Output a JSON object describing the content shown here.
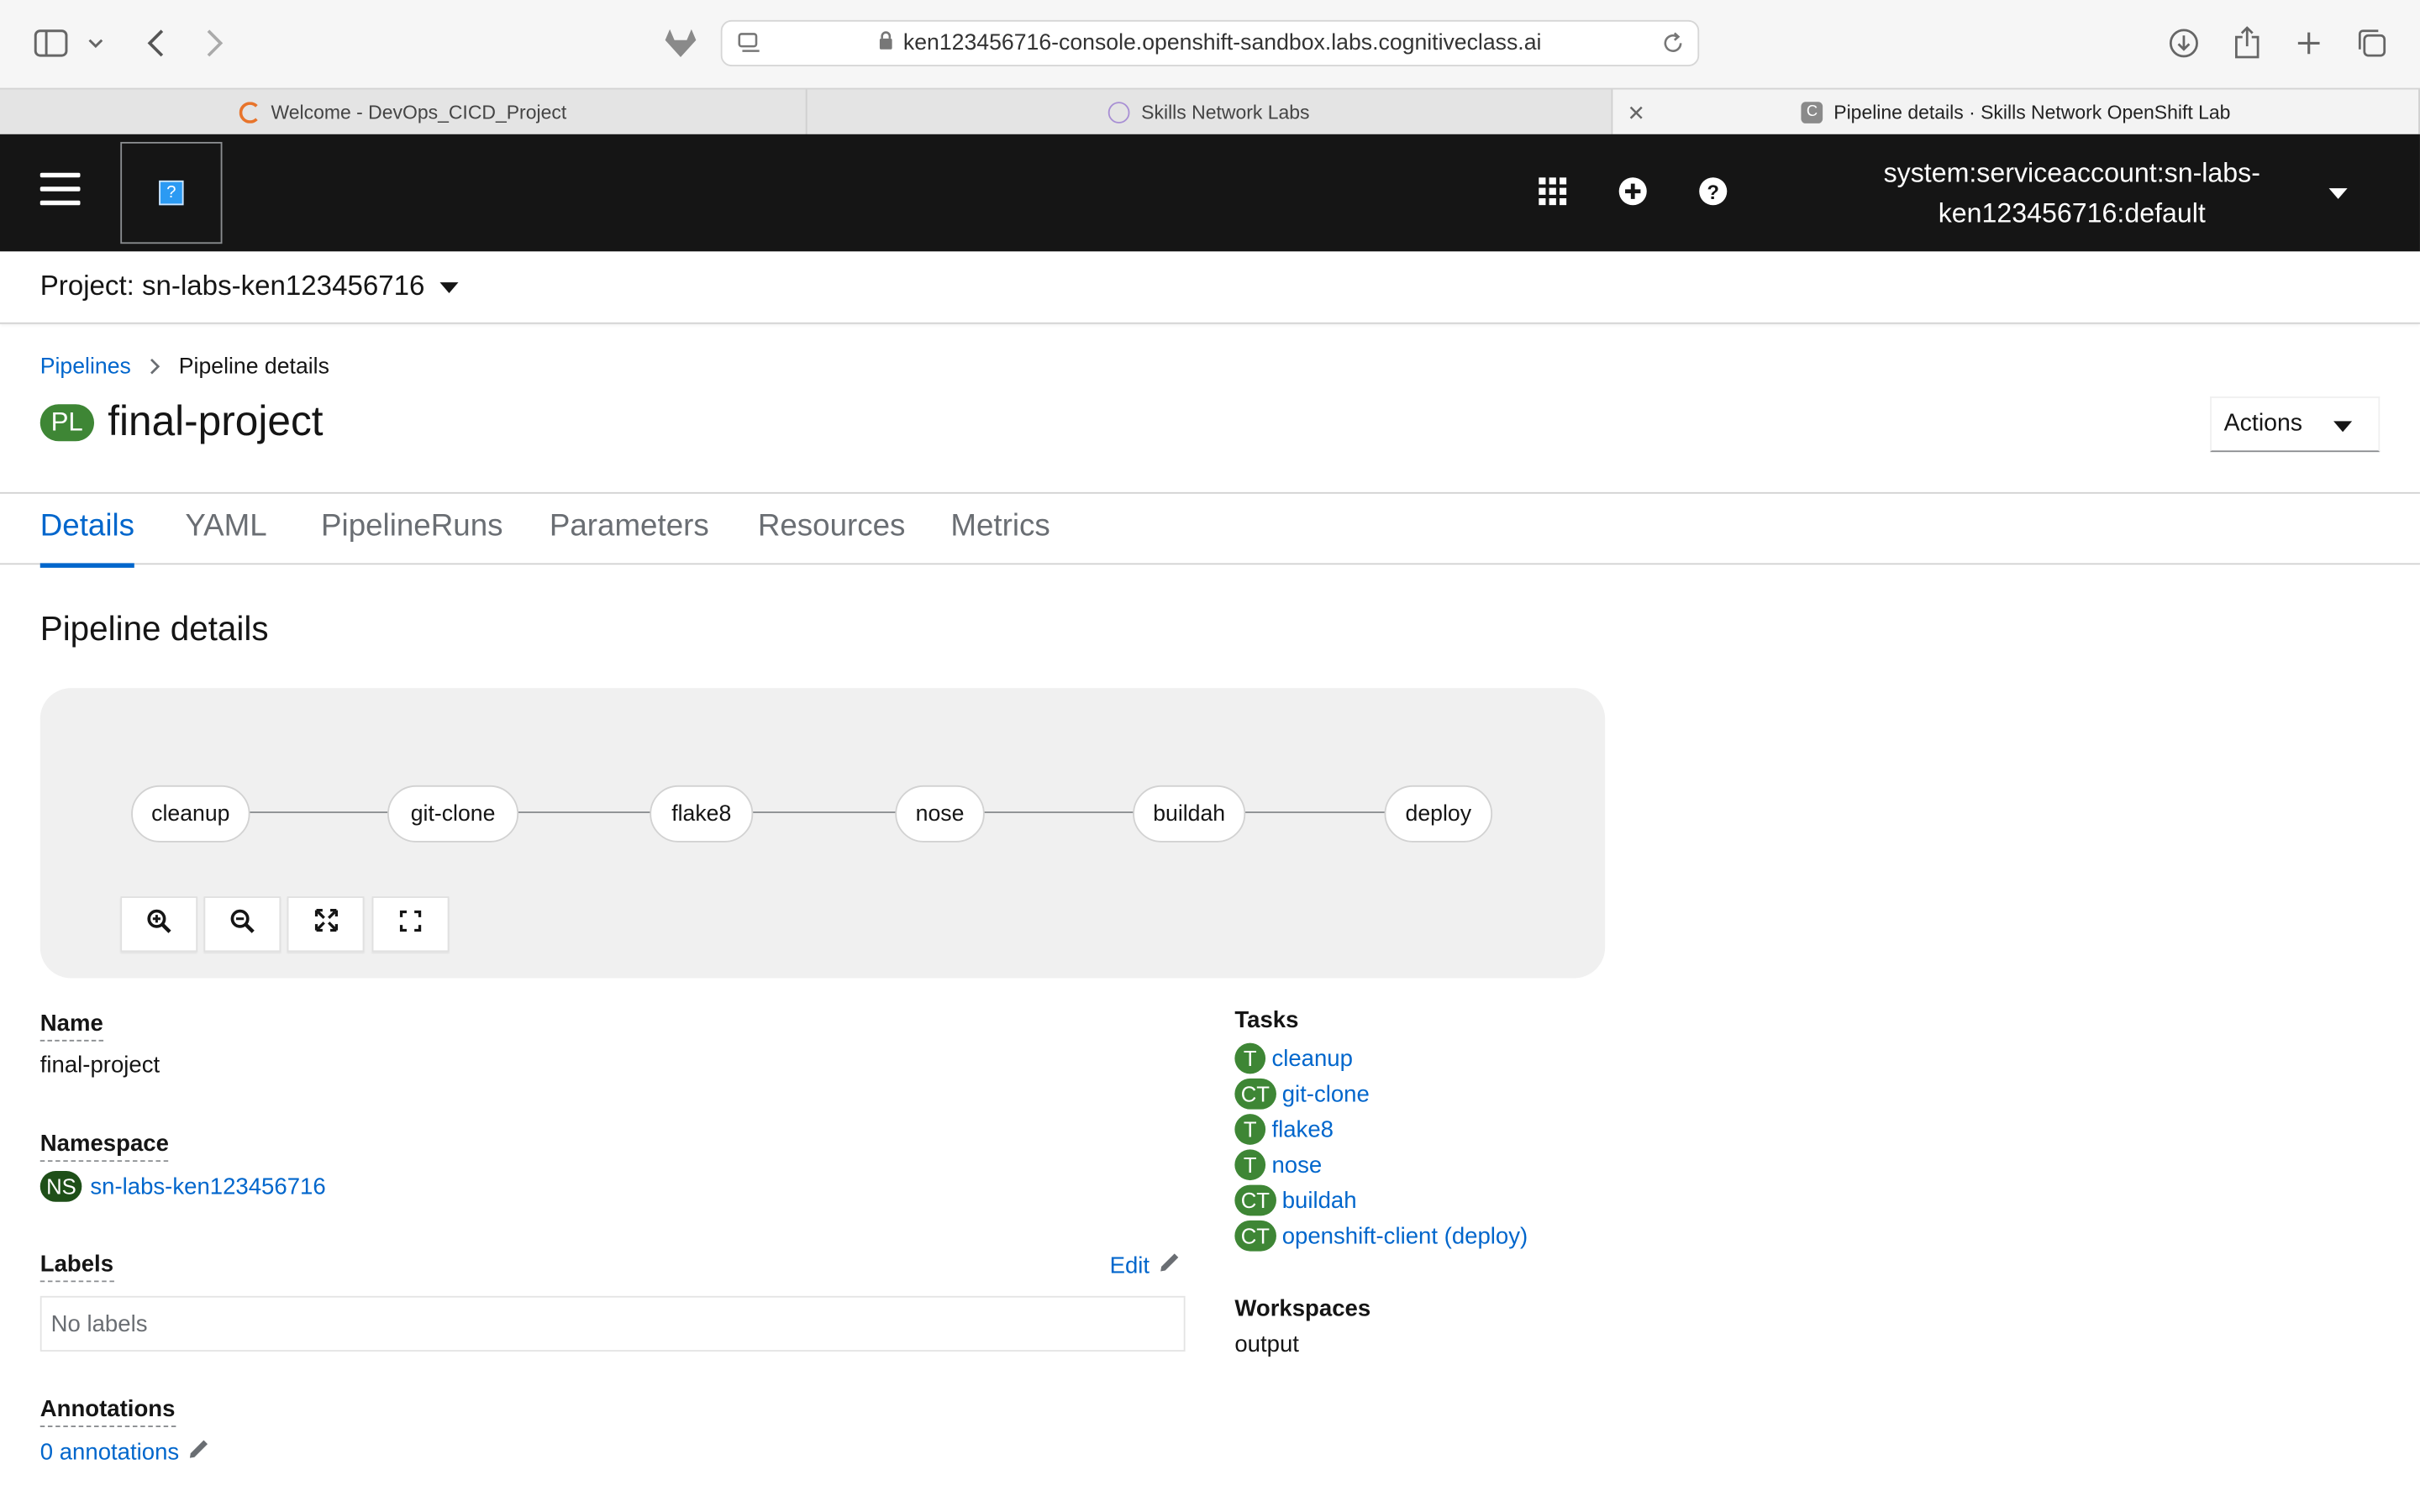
{
  "browser": {
    "url": "ken123456716-console.openshift-sandbox.labs.cognitiveclass.ai",
    "tabs": [
      {
        "label": "Welcome - DevOps_CICD_Project",
        "active": false
      },
      {
        "label": "Skills Network Labs",
        "active": false
      },
      {
        "label": "Pipeline details · Skills Network OpenShift Lab",
        "active": true
      }
    ],
    "favicon_letter": "C"
  },
  "masthead": {
    "logo_glyph": "?",
    "user_line1": "system:serviceaccount:sn-labs-",
    "user_line2": "ken123456716:default"
  },
  "project": {
    "label": "Project: sn-labs-ken123456716"
  },
  "breadcrumb": {
    "parent": "Pipelines",
    "current": "Pipeline details"
  },
  "page": {
    "badge": "PL",
    "title": "final-project",
    "actions_label": "Actions"
  },
  "tabs": [
    "Details",
    "YAML",
    "PipelineRuns",
    "Parameters",
    "Resources",
    "Metrics"
  ],
  "section_title": "Pipeline details",
  "pipeline_nodes": [
    "cleanup",
    "git-clone",
    "flake8",
    "nose",
    "buildah",
    "deploy"
  ],
  "details": {
    "name_label": "Name",
    "name_value": "final-project",
    "namespace_label": "Namespace",
    "namespace_badge": "NS",
    "namespace_value": "sn-labs-ken123456716",
    "labels_label": "Labels",
    "labels_edit": "Edit",
    "labels_empty": "No labels",
    "annotations_label": "Annotations",
    "annotations_value": "0 annotations",
    "tasks_label": "Tasks",
    "tasks": [
      {
        "badge": "T",
        "name": "cleanup"
      },
      {
        "badge": "CT",
        "name": "git-clone"
      },
      {
        "badge": "T",
        "name": "flake8"
      },
      {
        "badge": "T",
        "name": "nose"
      },
      {
        "badge": "CT",
        "name": "buildah"
      },
      {
        "badge": "CT",
        "name": "openshift-client (deploy)"
      }
    ],
    "workspaces_label": "Workspaces",
    "workspaces_value": "output"
  },
  "colors": {
    "link": "#0066cc",
    "badge_green": "#3e8635",
    "masthead": "#151515"
  }
}
